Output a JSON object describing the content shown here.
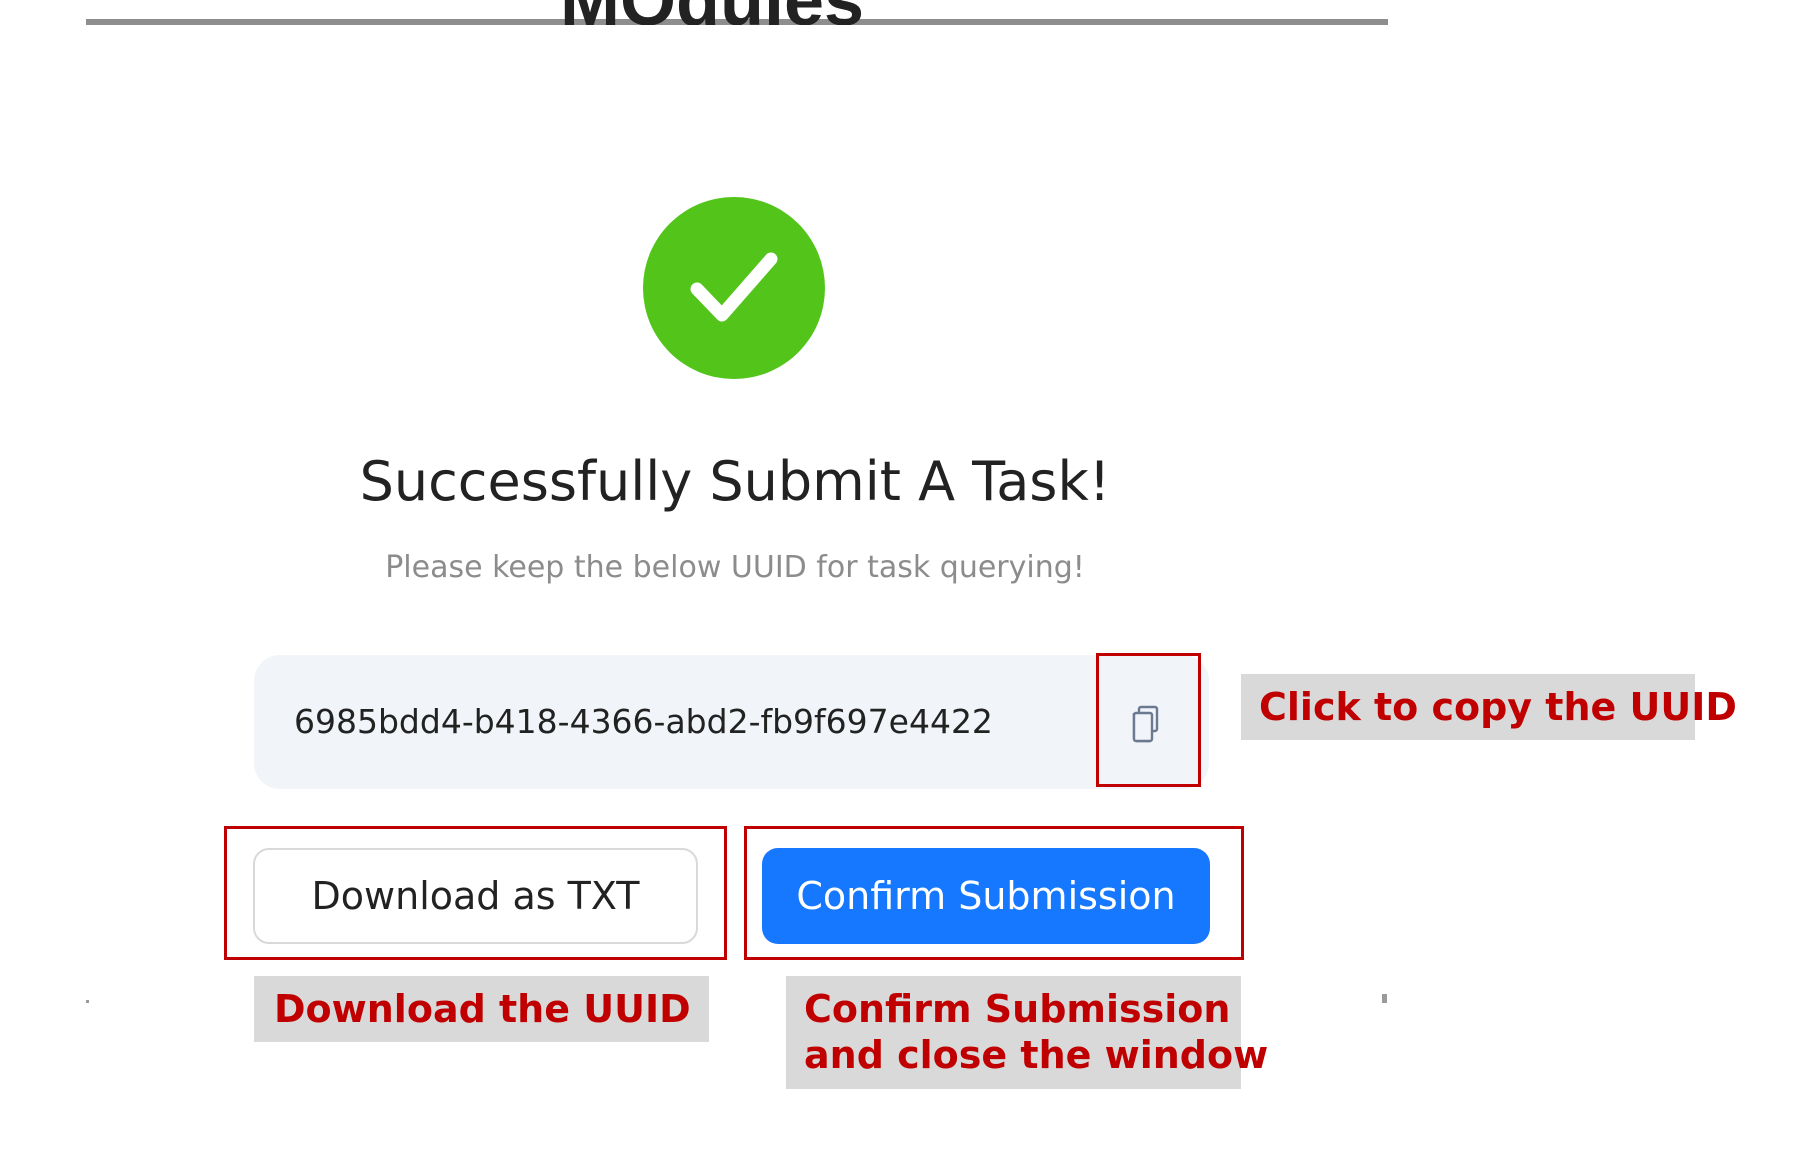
{
  "dialog": {
    "title": "Successfully Submit A Task!",
    "subtitle": "Please keep the below UUID for task querying!",
    "partial_heading": "MOdules",
    "uuid": "6985bdd4-b418-4366-abd2-fb9f697e4422",
    "success_color": "#52c41a"
  },
  "buttons": {
    "download_label": "Download as TXT",
    "confirm_label": "Confirm Submission",
    "confirm_color": "#1677ff"
  },
  "icons": {
    "status": "check-circle-icon",
    "copy": "copy-icon"
  },
  "annotations": {
    "copy_callout": "Click to copy the UUID",
    "download_callout": "Download the UUID",
    "confirm_callout_line1": "Confirm Submission",
    "confirm_callout_line2": "and close the window",
    "highlight_color": "#c00000",
    "callout_bg": "#d9d9d9"
  }
}
